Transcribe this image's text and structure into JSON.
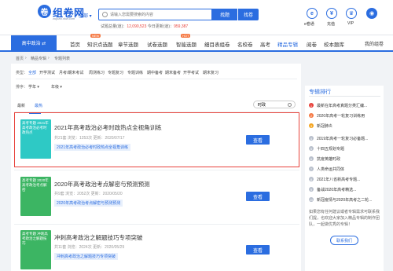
{
  "logo": {
    "mark": "卷",
    "name": "组卷网",
    "sub": "zujuan.xkw.com"
  },
  "region": "全部 ▾",
  "search": {
    "placeholder": "请输入您需要搜索的内容",
    "btn_juan": "找题",
    "btn_shi": "找卷"
  },
  "stats": {
    "prefix": "试题总量(道)：",
    "count1": "12,090,523",
    "mid": "  今日更新(道)：",
    "count2": "959,387"
  },
  "toolbar": [
    {
      "icon": "e",
      "label": "e卷通"
    },
    {
      "icon": "¥",
      "label": "充值"
    },
    {
      "icon": "♛",
      "label": "VIP"
    },
    {
      "icon": "◉",
      "label": ""
    }
  ],
  "nav": {
    "left": "高中政治  ⇄",
    "items": [
      "首页",
      "知识点选题",
      "章节选题",
      "试卷选题",
      "智能选题",
      "细目表组卷",
      "名校卷",
      "高考",
      "精品专辑",
      "阅卷",
      "校本题库"
    ],
    "hot1": "NEW",
    "hot2": "HOT",
    "my": "我的组卷"
  },
  "breadcrumb": [
    "首页",
    "›",
    "精品专辑",
    "›",
    "专题列表"
  ],
  "filters": {
    "label": "类型：",
    "chips": [
      "全部",
      "开学测试",
      "月考/期末考试",
      "周测练习",
      "专题复习",
      "专题训练",
      "期中备考",
      "期末备考",
      "开学考试",
      "期末复习"
    ]
  },
  "sort": {
    "label": "排序：",
    "a": "学年 ▾",
    "b": "年级 ▾"
  },
  "tabs": {
    "t1": "最新",
    "t2": "最热"
  },
  "filter_search": {
    "value": "时政"
  },
  "list": [
    {
      "cover": "高考专题 2021年高考政治必考时政热点",
      "title": "2021年高考政治必考时政热点全视角训练",
      "meta": "共21套   浏览：1253次   更新：2020/07/17",
      "tag": "2021年高考政治必考时政热点全视角训练",
      "btn": "查看"
    },
    {
      "cover": "高考专题 2020年高考政治考点解密",
      "title": "2020年高考政治考点解密与预测预测",
      "meta": "共9套   浏览：2052次   更新：2020/05/20",
      "tag": "2020年高考政治考点解密与预测预测",
      "btn": "查看"
    },
    {
      "cover": "高考专题 冲刺高考政治之解题技巧",
      "title": "冲刺高考政治之解题技巧专项突破",
      "meta": "共11套   浏览：2024次   更新：2020/05/29",
      "tag": "冲刺高考政治之解题技巧专项突破",
      "btn": "查看"
    }
  ],
  "right": {
    "title": "专辑排行",
    "items": [
      "最新在年高考真题分类汇编...",
      "2020年高考一轮复习训练用",
      "新冠肺炎",
      "2019年高考一轮复习必备题...",
      "十四五规划专题",
      "抗疫英雄时政",
      "人类命运共同体",
      "2021年八省新高考专题...",
      "备战2020年高考精选...",
      "新冠疫情与2020年高考之二轮..."
    ],
    "promo": "如果您有任何建议或者专辑需求可联系我们提，也欢迎大家加入精品专辑的制作团队，一起做优秀的专辑！",
    "btn": "联系我们"
  }
}
